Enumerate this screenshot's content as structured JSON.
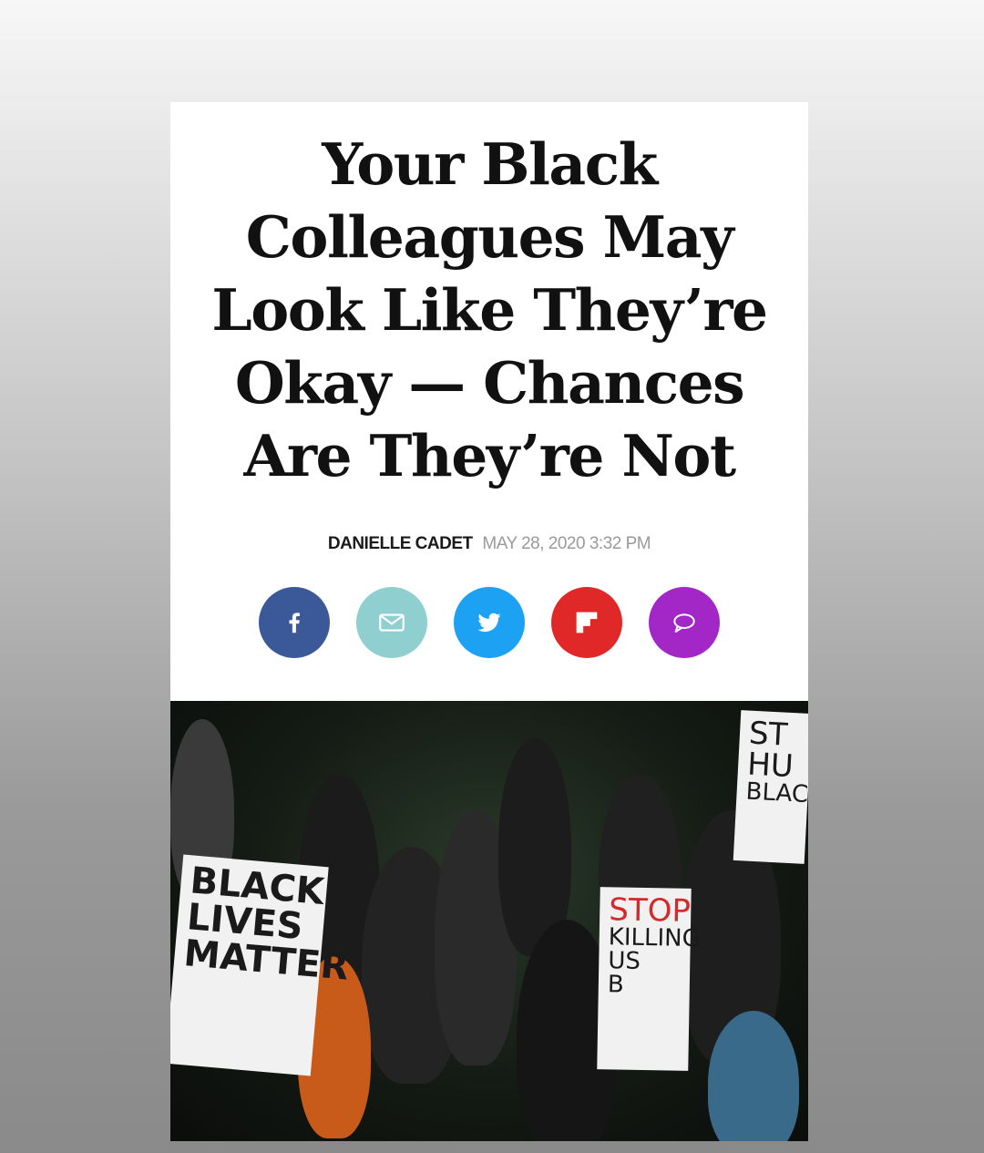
{
  "article": {
    "headline": "Your Black Colleagues May Look Like They’re Okay — Chances Are They’re Not",
    "author": "DANIELLE CADET",
    "date": "MAY 28, 2020 3:32 PM"
  },
  "share_buttons": [
    {
      "name": "facebook",
      "icon": "facebook-icon",
      "color": "#3b5998"
    },
    {
      "name": "email",
      "icon": "mail-icon",
      "color": "#8fcfd0"
    },
    {
      "name": "twitter",
      "icon": "twitter-icon",
      "color": "#1da1f2"
    },
    {
      "name": "flipboard",
      "icon": "flipboard-icon",
      "color": "#e12828"
    },
    {
      "name": "comments",
      "icon": "comment-icon",
      "color": "#a227c6"
    }
  ],
  "photo": {
    "signs": {
      "left": [
        "BLACK",
        "LIVES",
        "MATTER"
      ],
      "center_top": "STOP",
      "center_rest": [
        "KILLING",
        "US",
        "B"
      ],
      "right": [
        "ST",
        "HU",
        "BLAC"
      ]
    }
  }
}
